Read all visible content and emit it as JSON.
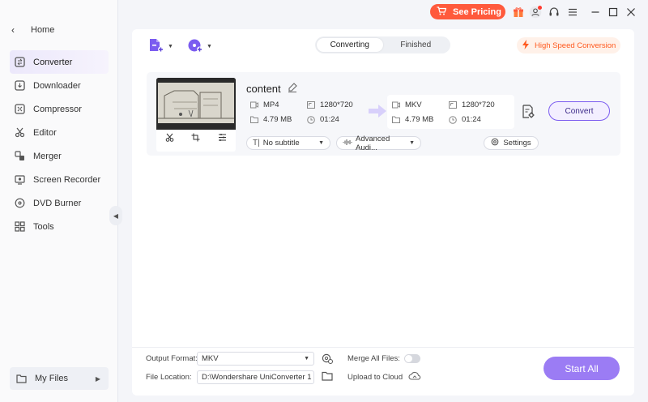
{
  "sidebar": {
    "home_label": "Home",
    "items": [
      {
        "label": "Converter",
        "icon": "converter-icon",
        "active": true
      },
      {
        "label": "Downloader",
        "icon": "downloader-icon"
      },
      {
        "label": "Compressor",
        "icon": "compressor-icon"
      },
      {
        "label": "Editor",
        "icon": "editor-icon"
      },
      {
        "label": "Merger",
        "icon": "merger-icon"
      },
      {
        "label": "Screen Recorder",
        "icon": "screen-recorder-icon"
      },
      {
        "label": "DVD Burner",
        "icon": "dvd-burner-icon"
      },
      {
        "label": "Tools",
        "icon": "tools-icon"
      }
    ],
    "my_files": "My Files"
  },
  "titlebar": {
    "pricing_label": "See Pricing"
  },
  "toolbar": {
    "tabs": [
      "Converting",
      "Finished"
    ],
    "active_tab": "Converting",
    "high_speed_label": "High Speed Conversion"
  },
  "file": {
    "name": "content",
    "source": {
      "format": "MP4",
      "resolution": "1280*720",
      "size": "4.79 MB",
      "duration": "01:24"
    },
    "target": {
      "format": "MKV",
      "resolution": "1280*720",
      "size": "4.79 MB",
      "duration": "01:24"
    },
    "subtitle": "No subtitle",
    "audio": "Advanced Audi...",
    "settings_label": "Settings",
    "convert_label": "Convert"
  },
  "bottom": {
    "output_format_label": "Output Format:",
    "output_format_value": "MKV",
    "file_location_label": "File Location:",
    "file_location_value": "D:\\Wondershare UniConverter 1",
    "merge_label": "Merge All Files:",
    "upload_label": "Upload to Cloud",
    "start_all_label": "Start All"
  },
  "colors": {
    "accent": "#7b5cf0",
    "pricing": "#ff5a3c",
    "start_all": "#9b7cf4"
  }
}
